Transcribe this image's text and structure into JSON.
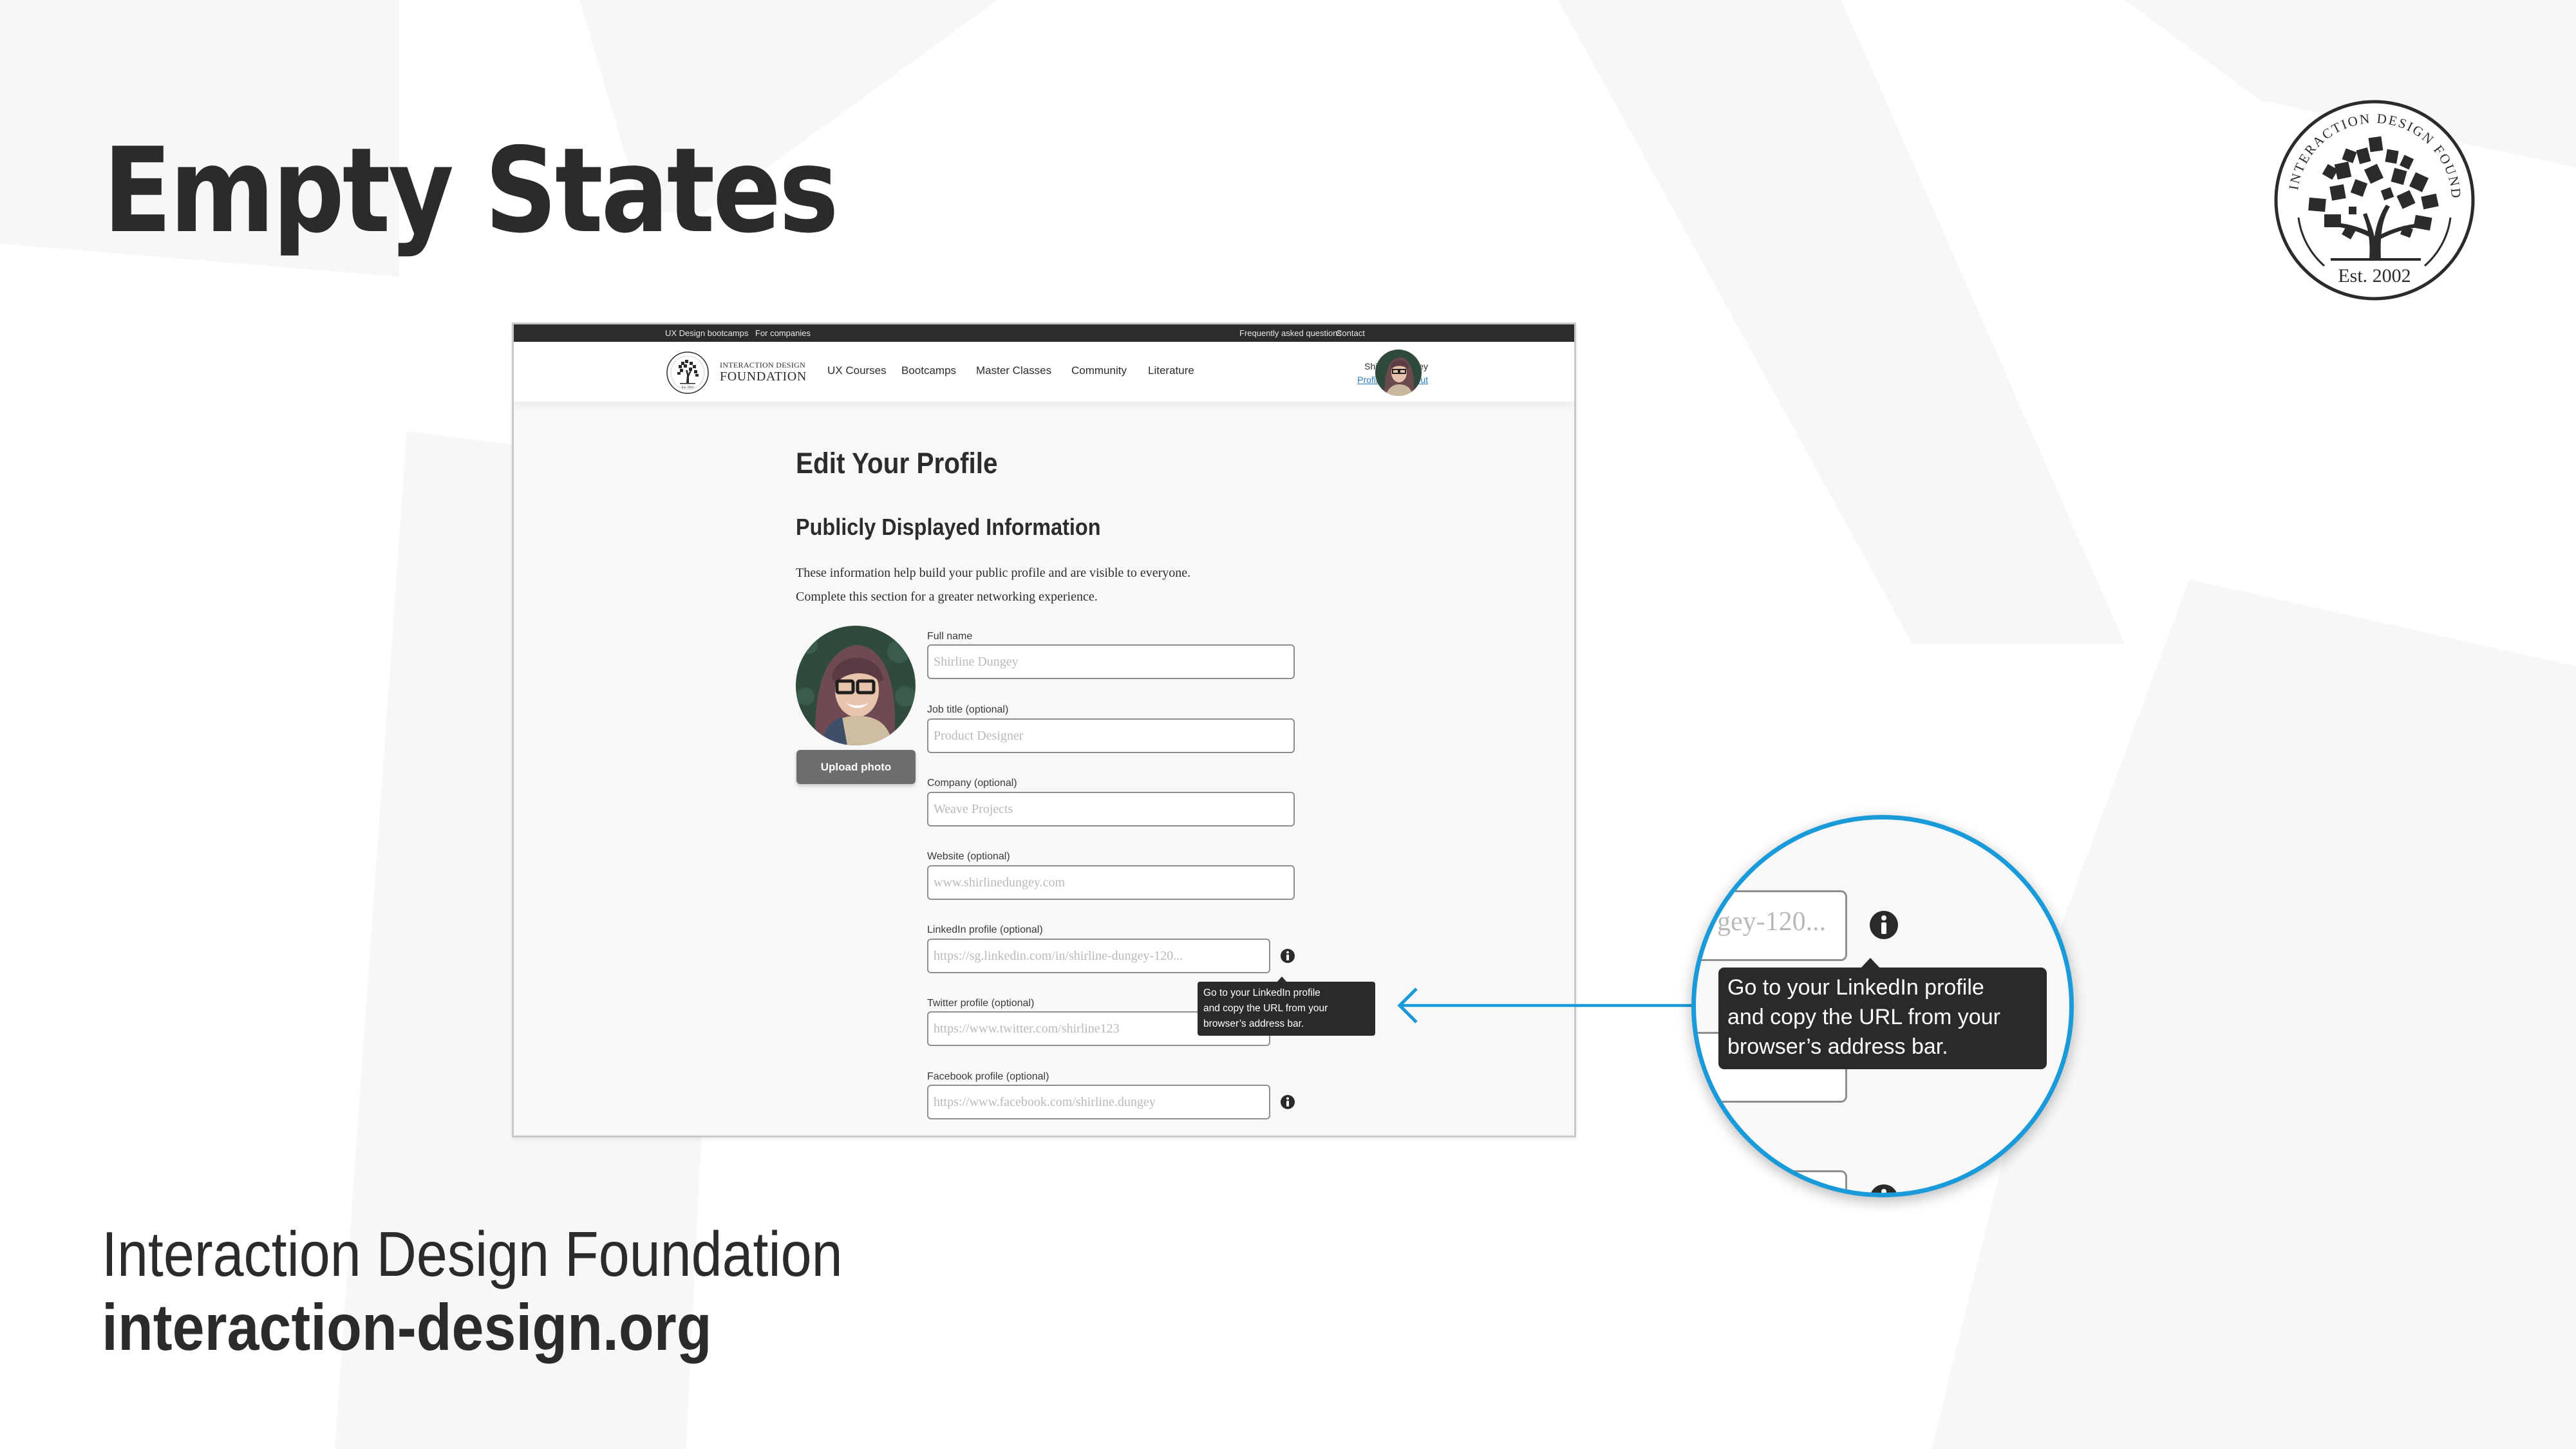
{
  "slide": {
    "title": "Empty States",
    "footer_org": "Interaction Design Foundation",
    "footer_url": "interaction-design.org",
    "logo": {
      "ring_text": "INTERACTION DESIGN FOUNDATION",
      "est_text": "Est. 2002"
    },
    "accent_color": "#1a9ad9"
  },
  "site": {
    "topbar": {
      "left_links": [
        "UX Design bootcamps",
        "For companies"
      ],
      "right_links": [
        "Frequently asked questions",
        "Contact"
      ]
    },
    "header": {
      "logo_line1": "INTERACTION DESIGN",
      "logo_line2": "FOUNDATION",
      "nav": [
        "UX Courses",
        "Bootcamps",
        "Master Classes",
        "Community",
        "Literature"
      ],
      "user_name": "Shirline Dungey",
      "profile_link": "Profile",
      "separator": "|",
      "logout_link": "Log out"
    }
  },
  "page": {
    "title": "Edit Your Profile",
    "section_title": "Publicly Displayed Information",
    "intro_line1": "These information help build your public profile and are visible to everyone.",
    "intro_line2": "Complete this section for a greater networking experience.",
    "upload_button": "Upload photo",
    "fields": [
      {
        "label": "Full name",
        "placeholder": "Shirline Dungey",
        "info": false
      },
      {
        "label": "Job title (optional)",
        "placeholder": "Product Designer",
        "info": false
      },
      {
        "label": "Company (optional)",
        "placeholder": "Weave Projects",
        "info": false
      },
      {
        "label": "Website (optional)",
        "placeholder": "www.shirlinedungey.com",
        "info": false
      },
      {
        "label": "LinkedIn profile (optional)",
        "placeholder": "https://sg.linkedin.com/in/shirline-dungey-120...",
        "info": true
      },
      {
        "label": "Twitter profile (optional)",
        "placeholder": "https://www.twitter.com/shirline123",
        "info": false
      },
      {
        "label": "Facebook profile (optional)",
        "placeholder": "https://www.facebook.com/shirline.dungey",
        "info": true
      }
    ],
    "tooltip": {
      "line1": "Go to your LinkedIn profile",
      "line2": "and copy the URL from your",
      "line3": "browser’s address bar."
    }
  },
  "magnifier": {
    "input_fragment": "gey-120...",
    "tooltip_line1": "Go to your LinkedIn profile",
    "tooltip_line2": "and copy the URL from your",
    "tooltip_line3": "browser’s address bar."
  }
}
